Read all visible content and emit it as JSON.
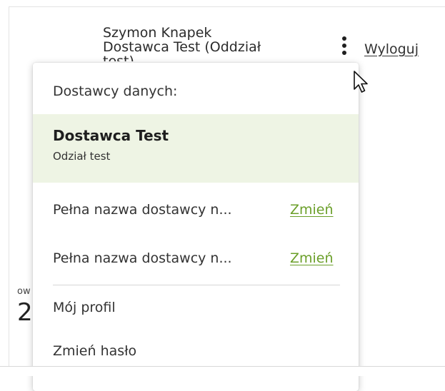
{
  "header": {
    "user_name": "Szymon Knapek",
    "user_company": "Dostawca Test (Oddział",
    "user_company_overflow": "test)",
    "logout_label": "Wyloguj",
    "menu_icon": "more-vertical-icon"
  },
  "background": {
    "label_fragment": "ow",
    "number_fragment": "2"
  },
  "dropdown": {
    "heading": "Dostawcy danych:",
    "selected": {
      "name": "Dostawca Test",
      "branch": "Odział test"
    },
    "providers": [
      {
        "label": "Pełna nazwa dostawcy n...",
        "action": "Zmień"
      },
      {
        "label": "Pełna nazwa dostawcy n...",
        "action": "Zmień"
      }
    ],
    "menu_items": [
      {
        "label": "Mój profil"
      },
      {
        "label": "Zmień hasło"
      }
    ]
  },
  "colors": {
    "accent_link": "#6b9f2a",
    "selected_bg": "#eef4e4"
  }
}
